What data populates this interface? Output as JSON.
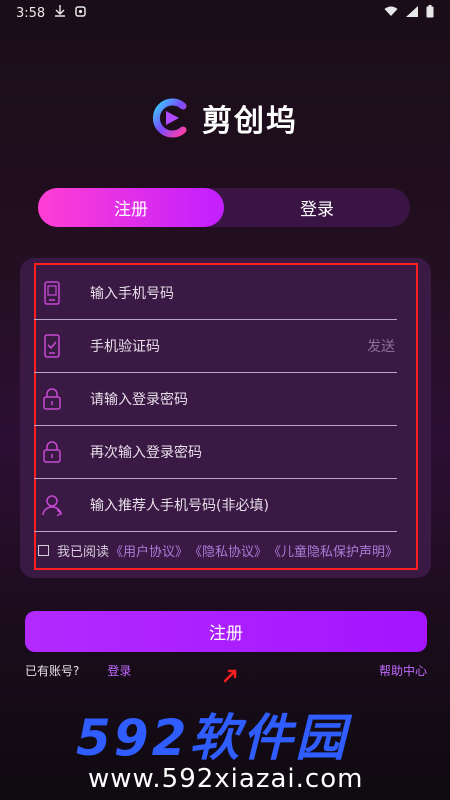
{
  "status": {
    "time": "3:58"
  },
  "app": {
    "name": "剪创坞"
  },
  "tabs": [
    {
      "label": "注册",
      "active": true
    },
    {
      "label": "登录",
      "active": false
    }
  ],
  "form": {
    "fields": [
      {
        "placeholder": "输入手机号码",
        "icon": "phone-icon"
      },
      {
        "placeholder": "手机验证码",
        "icon": "sms-verify-icon",
        "action": "发送"
      },
      {
        "placeholder": "请输入登录密码",
        "icon": "lock-icon"
      },
      {
        "placeholder": "再次输入登录密码",
        "icon": "lock-icon"
      },
      {
        "placeholder": "输入推荐人手机号码(非必填)",
        "icon": "referrer-user-icon"
      }
    ],
    "agreement": {
      "prefix": "我已阅读",
      "links": [
        "《用户协议》",
        "《隐私协议》",
        "《儿童隐私保护声明》"
      ]
    },
    "submit_label": "注册"
  },
  "footer": {
    "has_account": "已有账号?",
    "login_link": "登录",
    "help": "帮助中心"
  },
  "watermark": {
    "main": "592软件园",
    "sub": "www.592xiazai.com"
  },
  "colors": {
    "accent_pink": "#ff3fd3",
    "accent_purple": "#b22aff",
    "card_bg": "#3b1945",
    "highlight": "#ff1f1f",
    "watermark_blue": "#2f5dff"
  }
}
